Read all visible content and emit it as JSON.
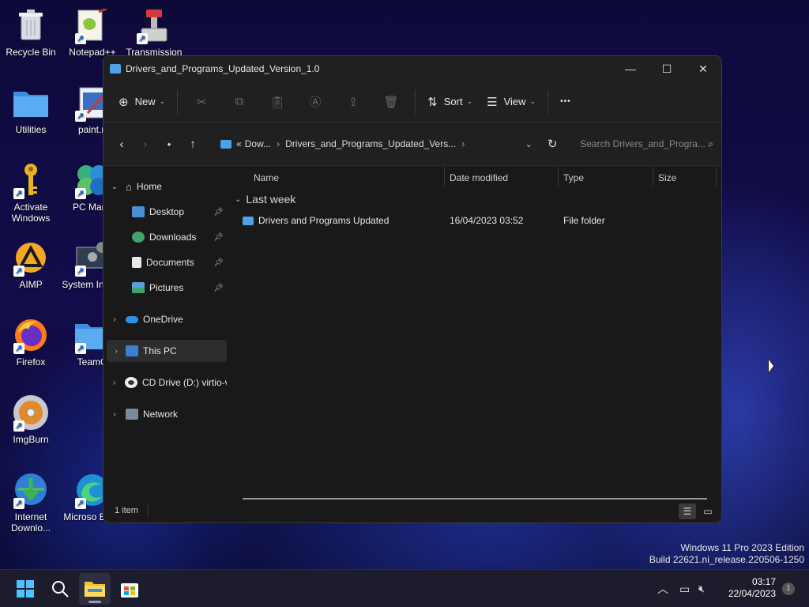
{
  "desktop": {
    "icons": [
      {
        "label": "Recycle Bin",
        "icon": "recycle-bin-icon",
        "shortcut": false
      },
      {
        "label": "Notepad++",
        "icon": "notepadpp-icon",
        "shortcut": true
      },
      {
        "label": "Transmission",
        "icon": "transmission-icon",
        "shortcut": true
      },
      {
        "label": "Utilities",
        "icon": "folder-icon",
        "shortcut": false
      },
      {
        "label": "paint.n",
        "icon": "paint-icon",
        "shortcut": true
      },
      {
        "label": "Activate Windows",
        "icon": "key-icon",
        "shortcut": true
      },
      {
        "label": "PC Mana",
        "icon": "pc-manager-icon",
        "shortcut": true
      },
      {
        "label": "AIMP",
        "icon": "aimp-icon",
        "shortcut": true
      },
      {
        "label": "System Inform",
        "icon": "system-info-icon",
        "shortcut": true
      },
      {
        "label": "Firefox",
        "icon": "firefox-icon",
        "shortcut": true
      },
      {
        "label": "TeamO",
        "icon": "teamviewer-folder-icon",
        "shortcut": true
      },
      {
        "label": "ImgBurn",
        "icon": "imgburn-icon",
        "shortcut": true
      },
      {
        "label": "Internet Downlo...",
        "icon": "idm-icon",
        "shortcut": true
      },
      {
        "label": "Microso Edge",
        "icon": "edge-icon",
        "shortcut": true
      }
    ]
  },
  "window": {
    "title": "Drivers_and_Programs_Updated_Version_1.0",
    "controls": {
      "minimize": "—",
      "maximize": "☐",
      "close": "✕"
    },
    "toolbar": {
      "new_label": "New",
      "sort_label": "Sort",
      "view_label": "View",
      "more_label": "•••"
    },
    "address": {
      "prefix": "«",
      "segments": [
        "Dow...",
        "Drivers_and_Programs_Updated_Vers..."
      ],
      "search_placeholder": "Search Drivers_and_Progra..."
    },
    "navpane": {
      "home": "Home",
      "quick": [
        {
          "label": "Desktop",
          "color": "#4a90d9"
        },
        {
          "label": "Downloads",
          "color": "#3fa36b"
        },
        {
          "label": "Documents",
          "color": "#e8e8e8"
        },
        {
          "label": "Pictures",
          "color": "#5aa0d8"
        }
      ],
      "onedrive": "OneDrive",
      "this_pc": "This PC",
      "cd_drive": "CD Drive (D:) virtio-v",
      "network": "Network"
    },
    "columns": {
      "name": "Name",
      "date": "Date modified",
      "type": "Type",
      "size": "Size"
    },
    "group_label": "Last week",
    "files": [
      {
        "name": "Drivers and Programs Updated",
        "date": "16/04/2023 03:52",
        "type": "File folder",
        "size": ""
      }
    ],
    "status": "1 item"
  },
  "watermark": {
    "line1": "Windows 11 Pro 2023 Edition",
    "line2": "Build 22621.ni_release.220506-1250"
  },
  "taskbar": {
    "time": "03:17",
    "date": "22/04/2023",
    "notification_count": "1"
  }
}
